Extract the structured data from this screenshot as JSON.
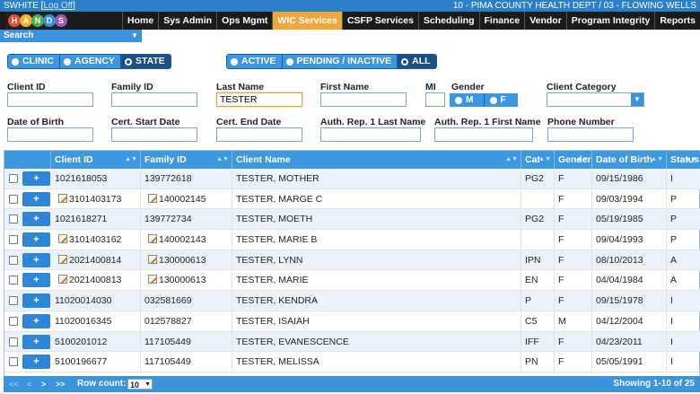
{
  "topbar": {
    "user": "SWHITE",
    "logoff": "Log Off",
    "org": "10 - PIMA COUNTY HEALTH DEPT / 03 - FLOWING WELLS"
  },
  "logo": {
    "letters": [
      "H",
      "A",
      "N",
      "D",
      "S"
    ],
    "colors": [
      "#e94b3c",
      "#f3b32a",
      "#4caf50",
      "#2f8fe0",
      "#9b59b6"
    ]
  },
  "nav": [
    "Home",
    "Sys Admin",
    "Ops Mgmt",
    "WIC Services",
    "CSFP Services",
    "Scheduling",
    "Finance",
    "Vendor",
    "Program Integrity",
    "Reports"
  ],
  "nav_active": "WIC Services",
  "search": {
    "label": "Search"
  },
  "scope_toggle": [
    "CLINIC",
    "AGENCY",
    "STATE"
  ],
  "scope_selected": "STATE",
  "status_toggle": [
    "ACTIVE",
    "PENDING / INACTIVE",
    "ALL"
  ],
  "status_selected": "ALL",
  "filters": {
    "client_id": "Client ID",
    "family_id": "Family ID",
    "last_name": "Last Name",
    "last_name_value": "TESTER",
    "first_name": "First Name",
    "mi": "MI",
    "gender": "Gender",
    "gender_m": "M",
    "gender_f": "F",
    "client_category": "Client Category",
    "dob": "Date of Birth",
    "cert_start": "Cert. Start Date",
    "cert_end": "Cert. End Date",
    "auth_last": "Auth. Rep. 1 Last Name",
    "auth_first": "Auth. Rep. 1 First Name",
    "phone": "Phone Number"
  },
  "table": {
    "headers": [
      "Client ID",
      "Family ID",
      "Client Name",
      "Cat",
      "Gender",
      "Date of Birth",
      "Status"
    ],
    "rows": [
      {
        "client_id": "1021618053",
        "family_id": "139772618",
        "name": "TESTER, MOTHER",
        "cat": "PG2",
        "gender": "F",
        "dob": "09/15/1986",
        "status": "I",
        "edit_client": false,
        "edit_family": false
      },
      {
        "client_id": "3101403173",
        "family_id": "140002145",
        "name": "TESTER, MARGE C",
        "cat": "",
        "gender": "F",
        "dob": "09/03/1994",
        "status": "P",
        "edit_client": true,
        "edit_family": true
      },
      {
        "client_id": "1021618271",
        "family_id": "139772734",
        "name": "TESTER, MOETH",
        "cat": "PG2",
        "gender": "F",
        "dob": "05/19/1985",
        "status": "P",
        "edit_client": false,
        "edit_family": false
      },
      {
        "client_id": "3101403162",
        "family_id": "140002143",
        "name": "TESTER, MARIE B",
        "cat": "",
        "gender": "F",
        "dob": "09/04/1993",
        "status": "P",
        "edit_client": true,
        "edit_family": true
      },
      {
        "client_id": "2021400814",
        "family_id": "130000613",
        "name": "TESTER, LYNN",
        "cat": "IPN",
        "gender": "F",
        "dob": "08/10/2013",
        "status": "A",
        "edit_client": true,
        "edit_family": true
      },
      {
        "client_id": "2021400813",
        "family_id": "130000613",
        "name": "TESTER, MARIE",
        "cat": "EN",
        "gender": "F",
        "dob": "04/04/1984",
        "status": "A",
        "edit_client": true,
        "edit_family": true
      },
      {
        "client_id": "11020014030",
        "family_id": "032581669",
        "name": "TESTER, KENDRA",
        "cat": "P",
        "gender": "F",
        "dob": "09/15/1978",
        "status": "I",
        "edit_client": false,
        "edit_family": false
      },
      {
        "client_id": "11020016345",
        "family_id": "012578827",
        "name": "TESTER, ISAIAH",
        "cat": "C5",
        "gender": "M",
        "dob": "04/12/2004",
        "status": "I",
        "edit_client": false,
        "edit_family": false
      },
      {
        "client_id": "5100201012",
        "family_id": "117105449",
        "name": "TESTER, EVANESCENCE",
        "cat": "IFF",
        "gender": "F",
        "dob": "04/23/2011",
        "status": "I",
        "edit_client": false,
        "edit_family": false
      },
      {
        "client_id": "5100196677",
        "family_id": "117105449",
        "name": "TESTER, MELISSA",
        "cat": "PN",
        "gender": "F",
        "dob": "05/05/1991",
        "status": "I",
        "edit_client": false,
        "edit_family": false
      }
    ],
    "plus_label": "+"
  },
  "pager": {
    "first": "<<",
    "prev": "<",
    "next": ">",
    "last": ">>",
    "row_count_label": "Row count:",
    "row_count": "10",
    "showing": "Showing 1-10 of 25"
  }
}
